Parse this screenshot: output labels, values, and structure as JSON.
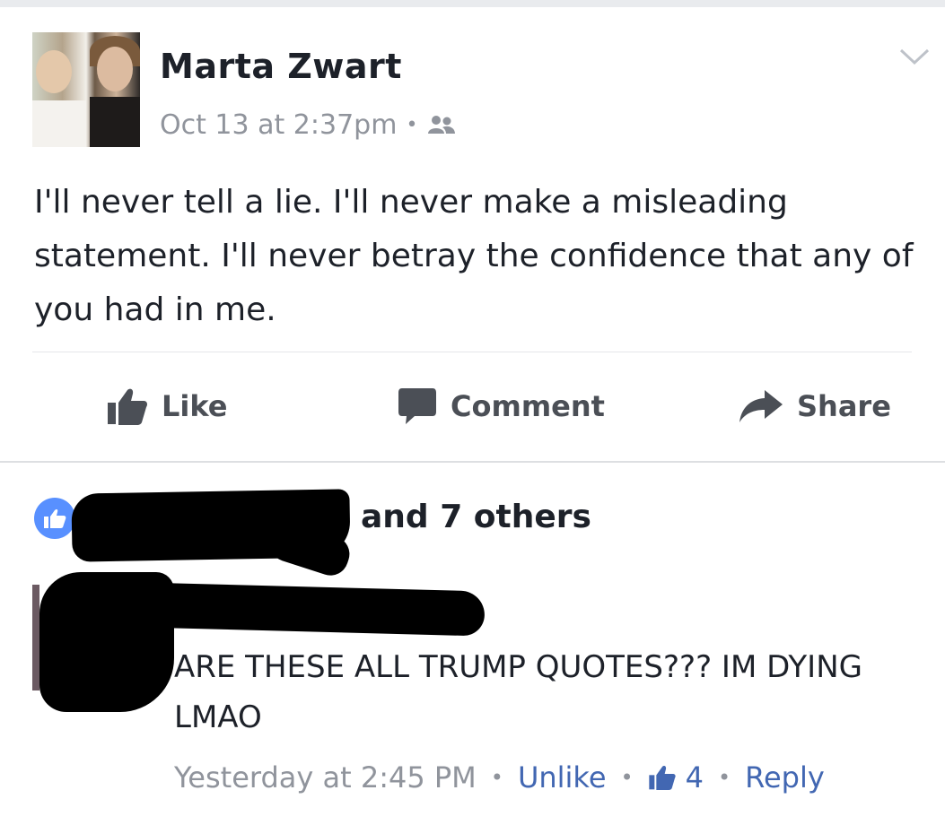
{
  "post": {
    "author": "Marta Zwart",
    "timestamp": "Oct 13 at 2:37pm",
    "separator": "•",
    "audience_icon": "friends-icon",
    "body": "I'll never tell a lie. I'll never make a misleading statement. I'll never betray the confidence that any of you had in me.",
    "actions": {
      "like": "Like",
      "comment": "Comment",
      "share": "Share"
    }
  },
  "reactions": {
    "icon": "like-icon",
    "text": "and 7 others"
  },
  "comment": {
    "text": "ARE THESE ALL TRUMP QUOTES??? IM DYING LMAO",
    "timestamp": "Yesterday at 2:45 PM",
    "unlike": "Unlike",
    "like_count": "4",
    "reply": "Reply",
    "separator": "•"
  },
  "colors": {
    "link": "#4267b2",
    "muted": "#90949c",
    "like_badge": "#5890ff",
    "text": "#1d2129"
  }
}
